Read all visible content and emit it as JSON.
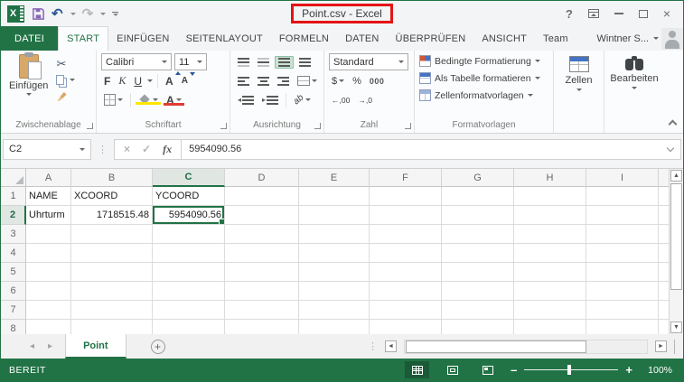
{
  "window": {
    "title": "Point.csv - Excel"
  },
  "glyphs": {
    "undo": "↶",
    "redo": "↷",
    "scissors": "✂",
    "cancel": "×",
    "check": "✓",
    "close": "×",
    "help": "?",
    "dots": "⋮",
    "nav_left": "◂",
    "nav_right": "▸",
    "scroll_up": "▲",
    "scroll_down": "▼",
    "scroll_left": "◄",
    "scroll_right": "►",
    "indent_out": "◂",
    "indent_in": "▸",
    "add_sheet": "+",
    "zoom_minus": "–",
    "zoom_plus": "+",
    "wrap": "ab"
  },
  "ribbon_tabs": {
    "file": "DATEI",
    "tabs": [
      "START",
      "EINFÜGEN",
      "SEITENLAYOUT",
      "FORMELN",
      "DATEN",
      "ÜBERPRÜFEN",
      "ANSICHT",
      "Team"
    ],
    "active": "START",
    "account": "Wintner S..."
  },
  "ribbon": {
    "clipboard": {
      "group_label": "Zwischenablage",
      "paste_label": "Einfügen"
    },
    "font": {
      "group_label": "Schriftart",
      "family": "Calibri",
      "size": "11",
      "bold": "F",
      "italic": "K",
      "underline": "U",
      "grow": "A",
      "shrink": "A",
      "color_letter": "A"
    },
    "alignment": {
      "group_label": "Ausrichtung",
      "orientation": "ab"
    },
    "number": {
      "group_label": "Zahl",
      "format": "Standard",
      "currency": "$",
      "percent": "%",
      "thousands": "000",
      "dec_increase": "←,00",
      "dec_decrease": "→,0"
    },
    "styles": {
      "group_label": "Formatvorlagen",
      "items": [
        "Bedingte Formatierung",
        "Als Tabelle formatieren",
        "Zellenformatvorlagen"
      ]
    },
    "cells": {
      "group_label": "Zellen"
    },
    "editing": {
      "group_label": "Bearbeiten"
    }
  },
  "formula_bar": {
    "name_box": "C2",
    "fx": "fx",
    "value": "5954090.56"
  },
  "grid": {
    "columns": [
      "A",
      "B",
      "C",
      "D",
      "E",
      "F",
      "G",
      "H",
      "I"
    ],
    "rows": [
      1,
      2,
      3,
      4,
      5,
      6,
      7,
      8
    ],
    "cells": {
      "A1": "NAME",
      "B1": "XCOORD",
      "C1": "YCOORD",
      "A2": "Uhrturm",
      "B2": "1718515.48",
      "C2": "5954090.56"
    },
    "right_aligned": [
      "B2",
      "C2"
    ],
    "selected_cell": "C2",
    "selected_column": "C",
    "selected_row": 2
  },
  "sheet_tabs": {
    "active": "Point"
  },
  "status_bar": {
    "mode": "BEREIT",
    "zoom_level": "100%"
  },
  "colors": {
    "excel_green": "#217346",
    "highlight_red": "#e31414",
    "save_purple": "#8764b8",
    "undo_blue": "#2b579a",
    "fill_yellow": "#ffe600",
    "font_red": "#e03c31"
  }
}
